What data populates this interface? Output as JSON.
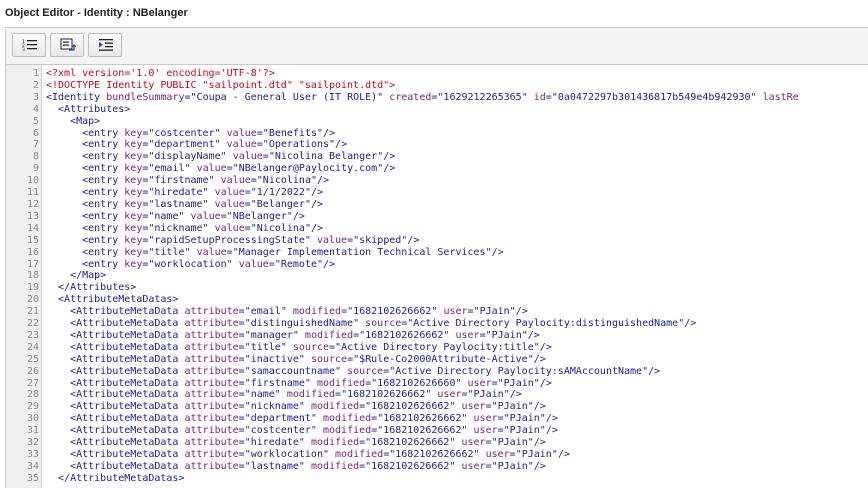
{
  "window": {
    "title": "Object Editor - Identity : NBelanger"
  },
  "toolbar": {
    "buttons": [
      {
        "icon": "line-numbers-icon"
      },
      {
        "icon": "wrap-toggle-icon"
      },
      {
        "icon": "indent-icon"
      }
    ]
  },
  "editor": {
    "lines": [
      [
        [
          "red",
          "<?xml version='1.0' encoding='UTF-8'?>"
        ]
      ],
      [
        [
          "red",
          "<!DOCTYPE Identity PUBLIC \"sailpoint.dtd\" \"sailpoint.dtd\">"
        ]
      ],
      [
        [
          "tag",
          "<Identity "
        ],
        [
          "attr",
          "bundleSummary"
        ],
        [
          "tag",
          "="
        ],
        [
          "val",
          "\"Coupa - General User (IT ROLE)\""
        ],
        [
          "tag",
          " "
        ],
        [
          "attr",
          "created"
        ],
        [
          "tag",
          "="
        ],
        [
          "val",
          "\"1629212265365\""
        ],
        [
          "tag",
          " "
        ],
        [
          "attr",
          "id"
        ],
        [
          "tag",
          "="
        ],
        [
          "val",
          "\"0a0472297b301436817b549e4b942930\""
        ],
        [
          "tag",
          " "
        ],
        [
          "attr",
          "lastRe"
        ]
      ],
      [
        [
          "tag",
          "  <Attributes>"
        ]
      ],
      [
        [
          "tag",
          "    <Map>"
        ]
      ],
      [
        [
          "tag",
          "      <entry "
        ],
        [
          "attr",
          "key"
        ],
        [
          "tag",
          "="
        ],
        [
          "val",
          "\"costcenter\""
        ],
        [
          "tag",
          " "
        ],
        [
          "attr",
          "value"
        ],
        [
          "tag",
          "="
        ],
        [
          "val",
          "\"Benefits\""
        ],
        [
          "tag",
          "/>"
        ]
      ],
      [
        [
          "tag",
          "      <entry "
        ],
        [
          "attr",
          "key"
        ],
        [
          "tag",
          "="
        ],
        [
          "val",
          "\"department\""
        ],
        [
          "tag",
          " "
        ],
        [
          "attr",
          "value"
        ],
        [
          "tag",
          "="
        ],
        [
          "val",
          "\"Operations\""
        ],
        [
          "tag",
          "/>"
        ]
      ],
      [
        [
          "tag",
          "      <entry "
        ],
        [
          "attr",
          "key"
        ],
        [
          "tag",
          "="
        ],
        [
          "val",
          "\"displayName\""
        ],
        [
          "tag",
          " "
        ],
        [
          "attr",
          "value"
        ],
        [
          "tag",
          "="
        ],
        [
          "val",
          "\"Nicolina Belanger\""
        ],
        [
          "tag",
          "/>"
        ]
      ],
      [
        [
          "tag",
          "      <entry "
        ],
        [
          "attr",
          "key"
        ],
        [
          "tag",
          "="
        ],
        [
          "val",
          "\"email\""
        ],
        [
          "tag",
          " "
        ],
        [
          "attr",
          "value"
        ],
        [
          "tag",
          "="
        ],
        [
          "val",
          "\"NBelanger@Paylocity.com\""
        ],
        [
          "tag",
          "/>"
        ]
      ],
      [
        [
          "tag",
          "      <entry "
        ],
        [
          "attr",
          "key"
        ],
        [
          "tag",
          "="
        ],
        [
          "val",
          "\"firstname\""
        ],
        [
          "tag",
          " "
        ],
        [
          "attr",
          "value"
        ],
        [
          "tag",
          "="
        ],
        [
          "val",
          "\"Nicolina\""
        ],
        [
          "tag",
          "/>"
        ]
      ],
      [
        [
          "tag",
          "      <entry "
        ],
        [
          "attr",
          "key"
        ],
        [
          "tag",
          "="
        ],
        [
          "val",
          "\"hiredate\""
        ],
        [
          "tag",
          " "
        ],
        [
          "attr",
          "value"
        ],
        [
          "tag",
          "="
        ],
        [
          "val",
          "\"1/1/2022\""
        ],
        [
          "tag",
          "/>"
        ]
      ],
      [
        [
          "tag",
          "      <entry "
        ],
        [
          "attr",
          "key"
        ],
        [
          "tag",
          "="
        ],
        [
          "val",
          "\"lastname\""
        ],
        [
          "tag",
          " "
        ],
        [
          "attr",
          "value"
        ],
        [
          "tag",
          "="
        ],
        [
          "val",
          "\"Belanger\""
        ],
        [
          "tag",
          "/>"
        ]
      ],
      [
        [
          "tag",
          "      <entry "
        ],
        [
          "attr",
          "key"
        ],
        [
          "tag",
          "="
        ],
        [
          "val",
          "\"name\""
        ],
        [
          "tag",
          " "
        ],
        [
          "attr",
          "value"
        ],
        [
          "tag",
          "="
        ],
        [
          "val",
          "\"NBelanger\""
        ],
        [
          "tag",
          "/>"
        ]
      ],
      [
        [
          "tag",
          "      <entry "
        ],
        [
          "attr",
          "key"
        ],
        [
          "tag",
          "="
        ],
        [
          "val",
          "\"nickname\""
        ],
        [
          "tag",
          " "
        ],
        [
          "attr",
          "value"
        ],
        [
          "tag",
          "="
        ],
        [
          "val",
          "\"Nicolina\""
        ],
        [
          "tag",
          "/>"
        ]
      ],
      [
        [
          "tag",
          "      <entry "
        ],
        [
          "attr",
          "key"
        ],
        [
          "tag",
          "="
        ],
        [
          "val",
          "\"rapidSetupProcessingState\""
        ],
        [
          "tag",
          " "
        ],
        [
          "attr",
          "value"
        ],
        [
          "tag",
          "="
        ],
        [
          "val",
          "\"skipped\""
        ],
        [
          "tag",
          "/>"
        ]
      ],
      [
        [
          "tag",
          "      <entry "
        ],
        [
          "attr",
          "key"
        ],
        [
          "tag",
          "="
        ],
        [
          "val",
          "\"title\""
        ],
        [
          "tag",
          " "
        ],
        [
          "attr",
          "value"
        ],
        [
          "tag",
          "="
        ],
        [
          "val",
          "\"Manager Implementation Technical Services\""
        ],
        [
          "tag",
          "/>"
        ]
      ],
      [
        [
          "tag",
          "      <entry "
        ],
        [
          "attr",
          "key"
        ],
        [
          "tag",
          "="
        ],
        [
          "val",
          "\"worklocation\""
        ],
        [
          "tag",
          " "
        ],
        [
          "attr",
          "value"
        ],
        [
          "tag",
          "="
        ],
        [
          "val",
          "\"Remote\""
        ],
        [
          "tag",
          "/>"
        ]
      ],
      [
        [
          "tag",
          "    </Map>"
        ]
      ],
      [
        [
          "tag",
          "  </Attributes>"
        ]
      ],
      [
        [
          "tag",
          "  <AttributeMetaDatas>"
        ]
      ],
      [
        [
          "tag",
          "    <AttributeMetaData "
        ],
        [
          "attr",
          "attribute"
        ],
        [
          "tag",
          "="
        ],
        [
          "val",
          "\"email\""
        ],
        [
          "tag",
          " "
        ],
        [
          "attr",
          "modified"
        ],
        [
          "tag",
          "="
        ],
        [
          "val",
          "\"1682102626662\""
        ],
        [
          "tag",
          " "
        ],
        [
          "attr",
          "user"
        ],
        [
          "tag",
          "="
        ],
        [
          "val",
          "\"PJain\""
        ],
        [
          "tag",
          "/>"
        ]
      ],
      [
        [
          "tag",
          "    <AttributeMetaData "
        ],
        [
          "attr",
          "attribute"
        ],
        [
          "tag",
          "="
        ],
        [
          "val",
          "\"distinguishedName\""
        ],
        [
          "tag",
          " "
        ],
        [
          "attr",
          "source"
        ],
        [
          "tag",
          "="
        ],
        [
          "val",
          "\"Active Directory Paylocity:distinguishedName\""
        ],
        [
          "tag",
          "/>"
        ]
      ],
      [
        [
          "tag",
          "    <AttributeMetaData "
        ],
        [
          "attr",
          "attribute"
        ],
        [
          "tag",
          "="
        ],
        [
          "val",
          "\"manager\""
        ],
        [
          "tag",
          " "
        ],
        [
          "attr",
          "modified"
        ],
        [
          "tag",
          "="
        ],
        [
          "val",
          "\"1682102626662\""
        ],
        [
          "tag",
          " "
        ],
        [
          "attr",
          "user"
        ],
        [
          "tag",
          "="
        ],
        [
          "val",
          "\"PJain\""
        ],
        [
          "tag",
          "/>"
        ]
      ],
      [
        [
          "tag",
          "    <AttributeMetaData "
        ],
        [
          "attr",
          "attribute"
        ],
        [
          "tag",
          "="
        ],
        [
          "val",
          "\"title\""
        ],
        [
          "tag",
          " "
        ],
        [
          "attr",
          "source"
        ],
        [
          "tag",
          "="
        ],
        [
          "val",
          "\"Active Directory Paylocity:title\""
        ],
        [
          "tag",
          "/>"
        ]
      ],
      [
        [
          "tag",
          "    <AttributeMetaData "
        ],
        [
          "attr",
          "attribute"
        ],
        [
          "tag",
          "="
        ],
        [
          "val",
          "\"inactive\""
        ],
        [
          "tag",
          " "
        ],
        [
          "attr",
          "source"
        ],
        [
          "tag",
          "="
        ],
        [
          "val",
          "\"$Rule-Co2000Attribute-Active\""
        ],
        [
          "tag",
          "/>"
        ]
      ],
      [
        [
          "tag",
          "    <AttributeMetaData "
        ],
        [
          "attr",
          "attribute"
        ],
        [
          "tag",
          "="
        ],
        [
          "val",
          "\"samaccountname\""
        ],
        [
          "tag",
          " "
        ],
        [
          "attr",
          "source"
        ],
        [
          "tag",
          "="
        ],
        [
          "val",
          "\"Active Directory Paylocity:sAMAccountName\""
        ],
        [
          "tag",
          "/>"
        ]
      ],
      [
        [
          "tag",
          "    <AttributeMetaData "
        ],
        [
          "attr",
          "attribute"
        ],
        [
          "tag",
          "="
        ],
        [
          "val",
          "\"firstname\""
        ],
        [
          "tag",
          " "
        ],
        [
          "attr",
          "modified"
        ],
        [
          "tag",
          "="
        ],
        [
          "val",
          "\"1682102626660\""
        ],
        [
          "tag",
          " "
        ],
        [
          "attr",
          "user"
        ],
        [
          "tag",
          "="
        ],
        [
          "val",
          "\"PJain\""
        ],
        [
          "tag",
          "/>"
        ]
      ],
      [
        [
          "tag",
          "    <AttributeMetaData "
        ],
        [
          "attr",
          "attribute"
        ],
        [
          "tag",
          "="
        ],
        [
          "val",
          "\"name\""
        ],
        [
          "tag",
          " "
        ],
        [
          "attr",
          "modified"
        ],
        [
          "tag",
          "="
        ],
        [
          "val",
          "\"1682102626662\""
        ],
        [
          "tag",
          " "
        ],
        [
          "attr",
          "user"
        ],
        [
          "tag",
          "="
        ],
        [
          "val",
          "\"PJain\""
        ],
        [
          "tag",
          "/>"
        ]
      ],
      [
        [
          "tag",
          "    <AttributeMetaData "
        ],
        [
          "attr",
          "attribute"
        ],
        [
          "tag",
          "="
        ],
        [
          "val",
          "\"nickname\""
        ],
        [
          "tag",
          " "
        ],
        [
          "attr",
          "modified"
        ],
        [
          "tag",
          "="
        ],
        [
          "val",
          "\"1682102626662\""
        ],
        [
          "tag",
          " "
        ],
        [
          "attr",
          "user"
        ],
        [
          "tag",
          "="
        ],
        [
          "val",
          "\"PJain\""
        ],
        [
          "tag",
          "/>"
        ]
      ],
      [
        [
          "tag",
          "    <AttributeMetaData "
        ],
        [
          "attr",
          "attribute"
        ],
        [
          "tag",
          "="
        ],
        [
          "val",
          "\"department\""
        ],
        [
          "tag",
          " "
        ],
        [
          "attr",
          "modified"
        ],
        [
          "tag",
          "="
        ],
        [
          "val",
          "\"1682102626662\""
        ],
        [
          "tag",
          " "
        ],
        [
          "attr",
          "user"
        ],
        [
          "tag",
          "="
        ],
        [
          "val",
          "\"PJain\""
        ],
        [
          "tag",
          "/>"
        ]
      ],
      [
        [
          "tag",
          "    <AttributeMetaData "
        ],
        [
          "attr",
          "attribute"
        ],
        [
          "tag",
          "="
        ],
        [
          "val",
          "\"costcenter\""
        ],
        [
          "tag",
          " "
        ],
        [
          "attr",
          "modified"
        ],
        [
          "tag",
          "="
        ],
        [
          "val",
          "\"1682102626662\""
        ],
        [
          "tag",
          " "
        ],
        [
          "attr",
          "user"
        ],
        [
          "tag",
          "="
        ],
        [
          "val",
          "\"PJain\""
        ],
        [
          "tag",
          "/>"
        ]
      ],
      [
        [
          "tag",
          "    <AttributeMetaData "
        ],
        [
          "attr",
          "attribute"
        ],
        [
          "tag",
          "="
        ],
        [
          "val",
          "\"hiredate\""
        ],
        [
          "tag",
          " "
        ],
        [
          "attr",
          "modified"
        ],
        [
          "tag",
          "="
        ],
        [
          "val",
          "\"1682102626662\""
        ],
        [
          "tag",
          " "
        ],
        [
          "attr",
          "user"
        ],
        [
          "tag",
          "="
        ],
        [
          "val",
          "\"PJain\""
        ],
        [
          "tag",
          "/>"
        ]
      ],
      [
        [
          "tag",
          "    <AttributeMetaData "
        ],
        [
          "attr",
          "attribute"
        ],
        [
          "tag",
          "="
        ],
        [
          "val",
          "\"worklocation\""
        ],
        [
          "tag",
          " "
        ],
        [
          "attr",
          "modified"
        ],
        [
          "tag",
          "="
        ],
        [
          "val",
          "\"1682102626662\""
        ],
        [
          "tag",
          " "
        ],
        [
          "attr",
          "user"
        ],
        [
          "tag",
          "="
        ],
        [
          "val",
          "\"PJain\""
        ],
        [
          "tag",
          "/>"
        ]
      ],
      [
        [
          "tag",
          "    <AttributeMetaData "
        ],
        [
          "attr",
          "attribute"
        ],
        [
          "tag",
          "="
        ],
        [
          "val",
          "\"lastname\""
        ],
        [
          "tag",
          " "
        ],
        [
          "attr",
          "modified"
        ],
        [
          "tag",
          "="
        ],
        [
          "val",
          "\"1682102626662\""
        ],
        [
          "tag",
          " "
        ],
        [
          "attr",
          "user"
        ],
        [
          "tag",
          "="
        ],
        [
          "val",
          "\"PJain\""
        ],
        [
          "tag",
          "/>"
        ]
      ],
      [
        [
          "tag",
          "  </AttributeMetaDatas>"
        ]
      ]
    ]
  }
}
